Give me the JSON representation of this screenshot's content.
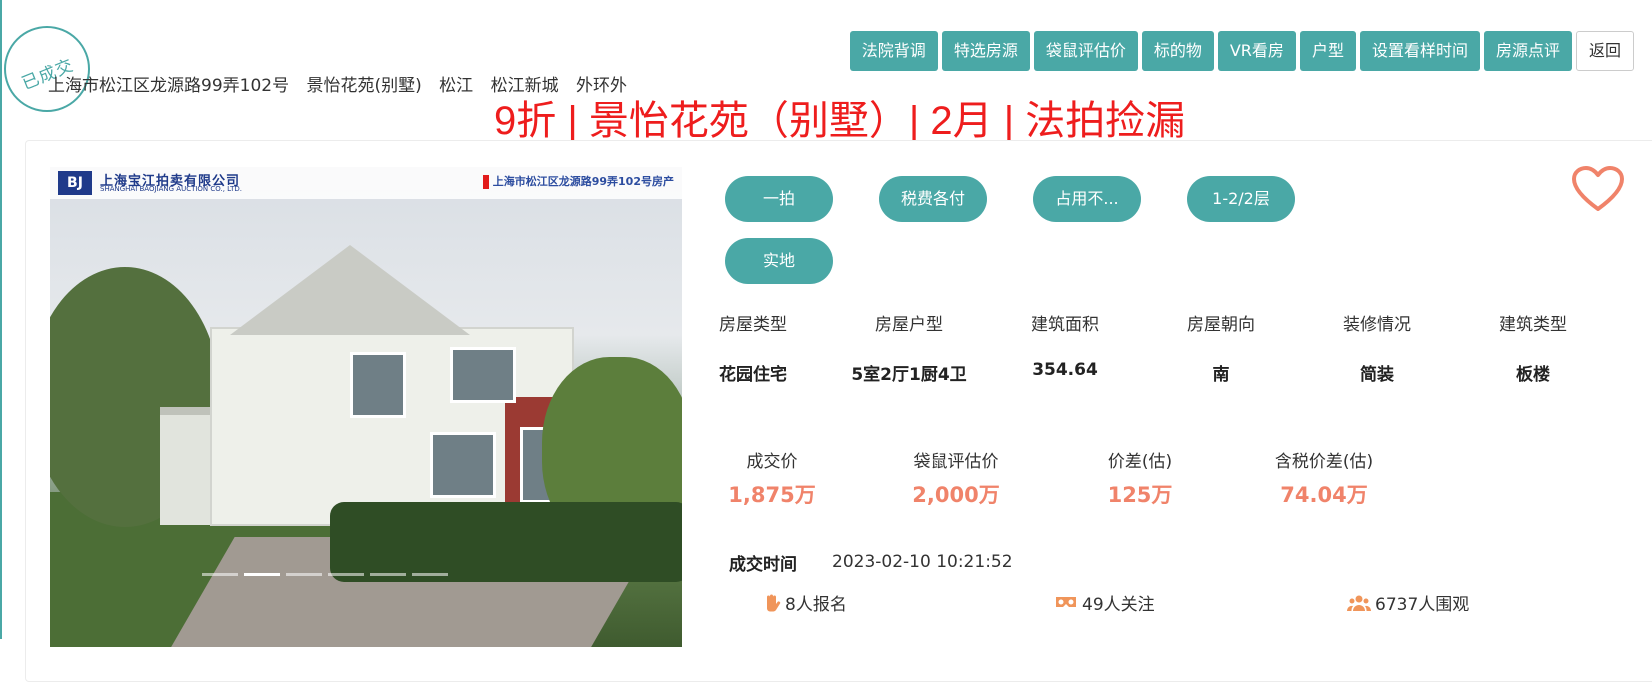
{
  "status_stamp": "已成交",
  "address": {
    "street": "上海市松江区龙源路99弄102号",
    "community": "景怡花苑(别墅)",
    "district": "松江",
    "area": "松江新城",
    "ring": "外环外"
  },
  "toolbar": {
    "buttons": [
      "法院背调",
      "特选房源",
      "袋鼠评估价",
      "标的物",
      "VR看房",
      "户型",
      "设置看样时间",
      "房源点评"
    ],
    "back_label": "返回"
  },
  "headline": "9折 | 景怡花苑（别墅）| 2月 | 法拍捡漏",
  "photo": {
    "company_cn": "上海宝江拍卖有限公司",
    "company_en": "SHANGHAI BAOJIANG AUCTION CO., LTD.",
    "caption": "上海市松江区龙源路99弄102号房产",
    "slide_count": 6,
    "active_slide": 2
  },
  "tags": [
    "一拍",
    "税费各付",
    "占用不...",
    "1-2/2层",
    "实地"
  ],
  "attributes": [
    {
      "label": "房屋类型",
      "value": "花园住宅"
    },
    {
      "label": "房屋户型",
      "value": "5室2厅1厨4卫"
    },
    {
      "label": "建筑面积",
      "value": "354.64"
    },
    {
      "label": "房屋朝向",
      "value": "南"
    },
    {
      "label": "装修情况",
      "value": "简装"
    },
    {
      "label": "建筑类型",
      "value": "板楼"
    }
  ],
  "prices": [
    {
      "label": "成交价",
      "value": "1,875万"
    },
    {
      "label": "袋鼠评估价",
      "value": "2,000万"
    },
    {
      "label": "价差(估)",
      "value": "125万"
    },
    {
      "label": "含税价差(估)",
      "value": "74.04万"
    }
  ],
  "deal": {
    "label": "成交时间",
    "time": "2023-02-10 10:21:52"
  },
  "stats": {
    "signups": "8人报名",
    "followers": "49人关注",
    "viewers": "6737人围观"
  },
  "colors": {
    "accent": "#4aa8a6",
    "headline": "#ee1d1d",
    "price": "#f0836a",
    "heart": "#f0836a"
  }
}
